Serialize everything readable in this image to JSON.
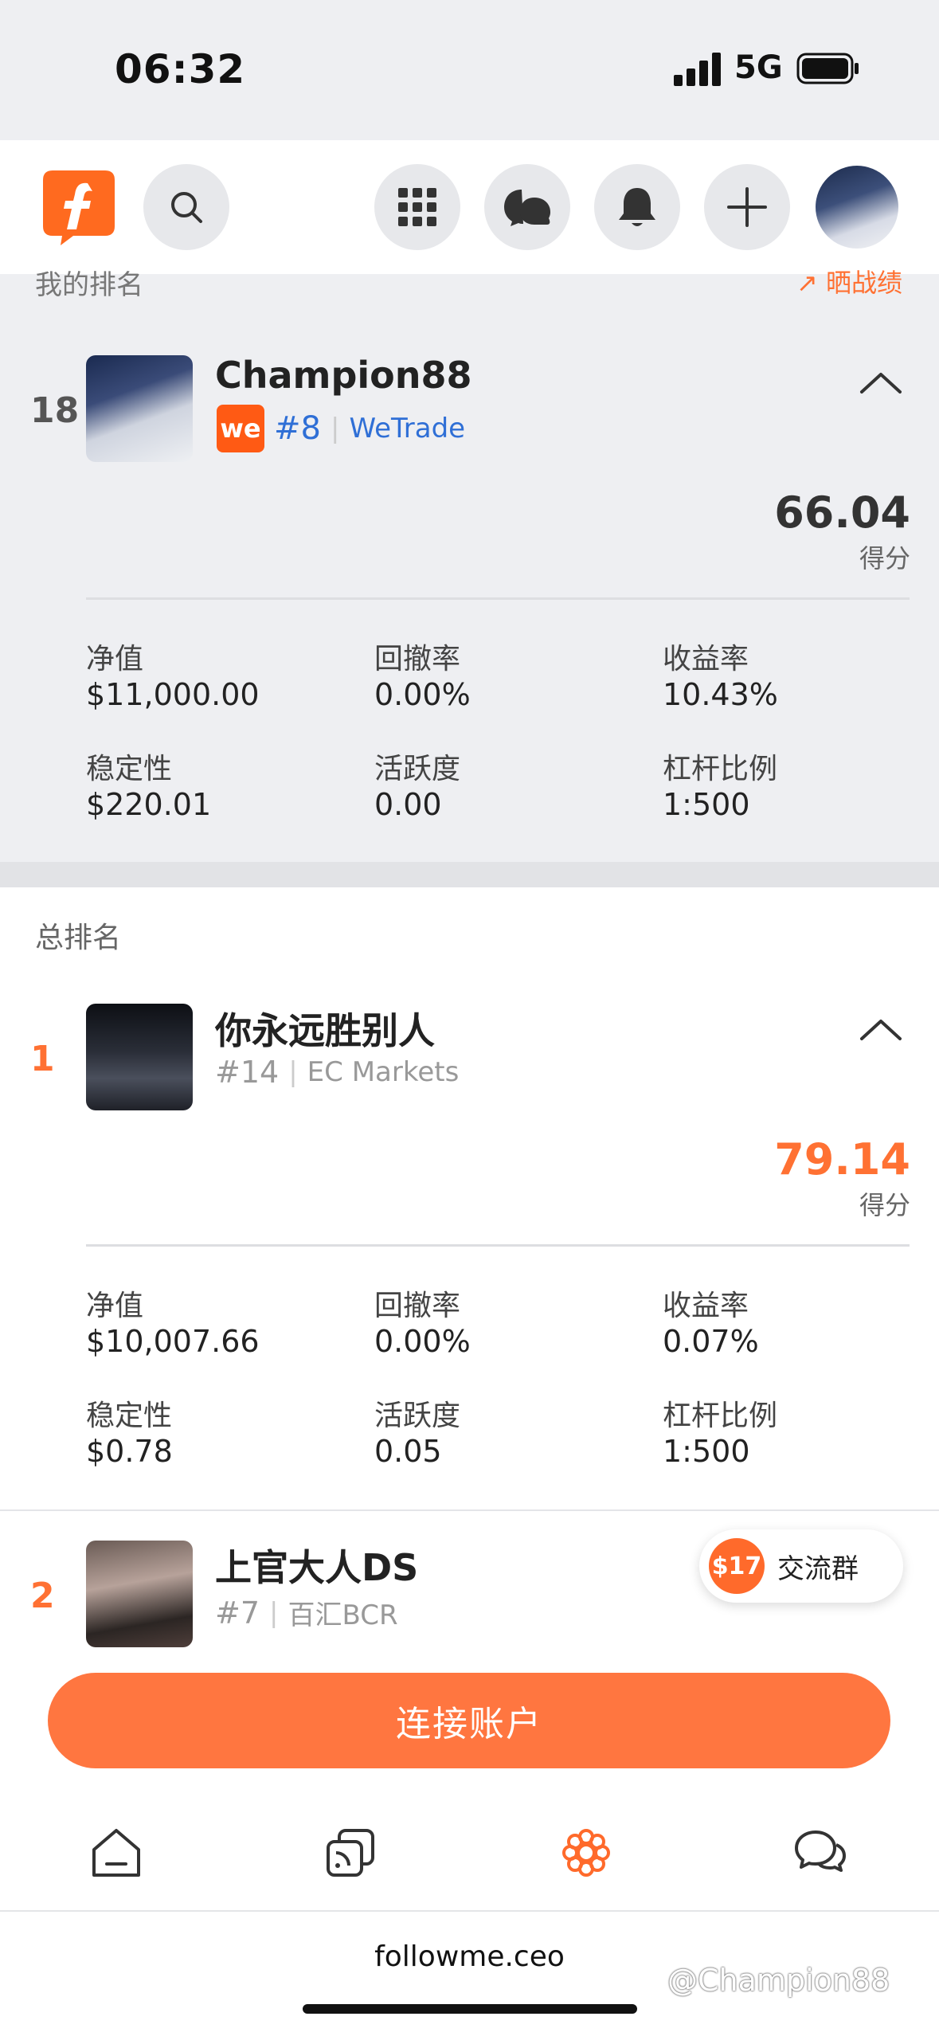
{
  "status_bar": {
    "time": "06:32",
    "network": "5G"
  },
  "my_rank_section": {
    "header": "我的排名",
    "share_label": "晒战绩",
    "entry": {
      "rank": "18",
      "name": "Champion88",
      "broker_badge": "we",
      "sub_rank": "#8",
      "broker": "WeTrade",
      "score": "66.04",
      "score_label": "得分",
      "stats": [
        {
          "label": "净值",
          "value": "$11,000.00"
        },
        {
          "label": "回撤率",
          "value": "0.00%"
        },
        {
          "label": "收益率",
          "value": "10.43%"
        },
        {
          "label": "稳定性",
          "value": "$220.01"
        },
        {
          "label": "活跃度",
          "value": "0.00"
        },
        {
          "label": "杠杆比例",
          "value": "1:500"
        }
      ]
    }
  },
  "total_section": {
    "header": "总排名",
    "entries": [
      {
        "rank": "1",
        "name": "你永远胜别人",
        "sub_rank": "#14",
        "broker": "EC Markets",
        "score": "79.14",
        "score_label": "得分",
        "stats": [
          {
            "label": "净值",
            "value": "$10,007.66"
          },
          {
            "label": "回撤率",
            "value": "0.00%"
          },
          {
            "label": "收益率",
            "value": "0.07%"
          },
          {
            "label": "稳定性",
            "value": "$0.78"
          },
          {
            "label": "活跃度",
            "value": "0.05"
          },
          {
            "label": "杠杆比例",
            "value": "1:500"
          }
        ]
      },
      {
        "rank": "2",
        "name": "上官大人DS",
        "sub_rank": "#7",
        "broker": "百汇BCR"
      }
    ]
  },
  "chat_pill": {
    "badge": "$17",
    "label": "交流群"
  },
  "connect_button": "连接账户",
  "url": "followme.ceo",
  "watermark": "@Champion88",
  "colors": {
    "accent": "#ff7133",
    "blue_link": "#2f6fd6",
    "card_bg": "#eeeff2"
  },
  "icons": [
    "search-icon",
    "grid-icon",
    "chat-bubbles-icon",
    "bell-icon",
    "plus-icon",
    "home-icon",
    "feed-icon",
    "rank-flower-icon",
    "message-icon"
  ]
}
